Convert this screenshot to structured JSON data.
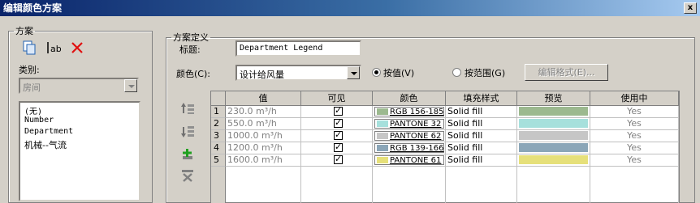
{
  "window": {
    "title": "编辑颜色方案",
    "close_glyph": "x"
  },
  "scheme_group": {
    "legend": "方案",
    "category_label": "类别:",
    "category_value": "房间",
    "items": [
      "(无)",
      "Number",
      "Department",
      "机械--气流"
    ],
    "selected_index": 3
  },
  "definition": {
    "legend": "方案定义",
    "title_label": "标题:",
    "title_value": "Department Legend",
    "color_label": "颜色(C):",
    "color_value": "设计给风量",
    "by_value_label": "按值(V)",
    "by_range_label": "按范围(G)",
    "edit_format_label": "编辑格式(E)...",
    "mode": "by_value"
  },
  "table": {
    "headers": [
      "值",
      "可见",
      "颜色",
      "填充样式",
      "预览",
      "使用中"
    ],
    "rows": [
      {
        "num": "1",
        "value": "230.0 m³/h",
        "visible": true,
        "color_label": "RGB 156-185",
        "swatch": "#9cb98f",
        "fill": "Solid fill",
        "in_use": "Yes"
      },
      {
        "num": "2",
        "value": "550.0 m³/h",
        "visible": true,
        "color_label": "PANTONE 32",
        "swatch": "#a6e0dc",
        "fill": "Solid fill",
        "in_use": "Yes"
      },
      {
        "num": "3",
        "value": "1000.0 m³/h",
        "visible": true,
        "color_label": "PANTONE 62",
        "swatch": "#c6c6c6",
        "fill": "Solid fill",
        "in_use": "Yes"
      },
      {
        "num": "4",
        "value": "1200.0 m³/h",
        "visible": true,
        "color_label": "RGB 139-166",
        "swatch": "#8ba6b8",
        "fill": "Solid fill",
        "in_use": "Yes"
      },
      {
        "num": "5",
        "value": "1600.0 m³/h",
        "visible": true,
        "color_label": "PANTONE 61",
        "swatch": "#e6e07a",
        "fill": "Solid fill",
        "in_use": "Yes"
      }
    ]
  }
}
